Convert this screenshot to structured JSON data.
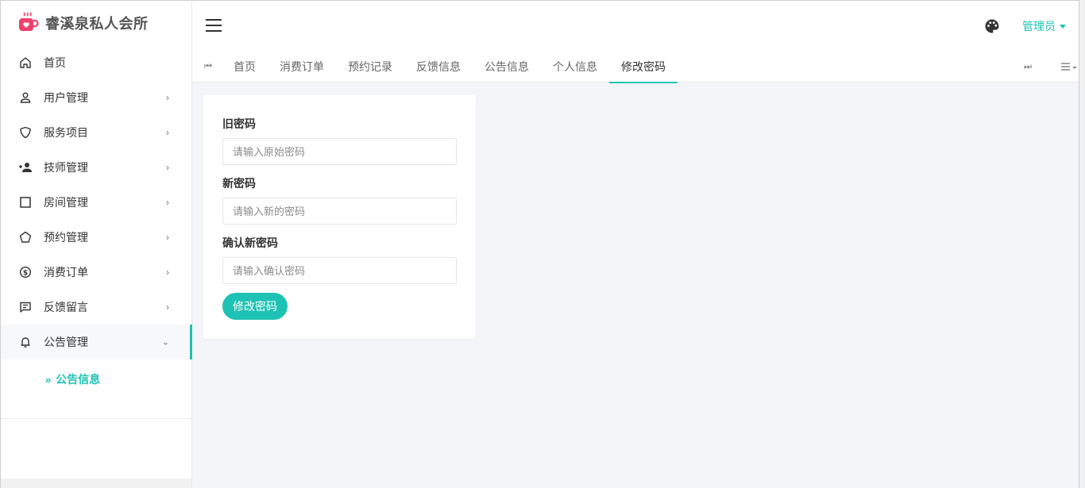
{
  "app": {
    "title": "睿溪泉私人会所"
  },
  "colors": {
    "accent": "#1ec2b4",
    "logo": "#ef3f6b"
  },
  "sidebar": {
    "items": [
      {
        "label": "首页",
        "icon": "home-icon",
        "has_arrow": false
      },
      {
        "label": "用户管理",
        "icon": "user-icon",
        "has_arrow": true
      },
      {
        "label": "服务项目",
        "icon": "shield-icon",
        "has_arrow": true
      },
      {
        "label": "技师管理",
        "icon": "person-add-icon",
        "has_arrow": true
      },
      {
        "label": "房间管理",
        "icon": "square-icon",
        "has_arrow": true
      },
      {
        "label": "预约管理",
        "icon": "pentagon-icon",
        "has_arrow": true
      },
      {
        "label": "消费订单",
        "icon": "dollar-circle-icon",
        "has_arrow": true
      },
      {
        "label": "反馈留言",
        "icon": "message-icon",
        "has_arrow": true
      },
      {
        "label": "公告管理",
        "icon": "bell-icon",
        "has_arrow": true,
        "expanded": true
      }
    ],
    "subitems": [
      {
        "label": "公告信息",
        "icon": "double-chevron-right-icon"
      }
    ]
  },
  "header": {
    "user": "管理员",
    "theme_icon": "palette-icon"
  },
  "tabs": [
    {
      "label": "首页"
    },
    {
      "label": "消费订单"
    },
    {
      "label": "预约记录"
    },
    {
      "label": "反馈信息"
    },
    {
      "label": "公告信息"
    },
    {
      "label": "个人信息"
    },
    {
      "label": "修改密码",
      "active": true
    }
  ],
  "form": {
    "old_password": {
      "label": "旧密码",
      "placeholder": "请输入原始密码"
    },
    "new_password": {
      "label": "新密码",
      "placeholder": "请输入新的密码"
    },
    "confirm_password": {
      "label": "确认新密码",
      "placeholder": "请输入确认密码"
    },
    "submit_label": "修改密码"
  }
}
